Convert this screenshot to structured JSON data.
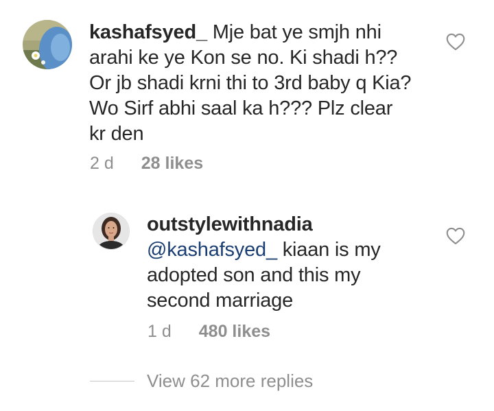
{
  "comments": [
    {
      "username": "kashafsyed_",
      "text": "Mje bat ye smjh nhi arahi ke ye Kon se no. Ki shadi h?? Or jb shadi krni thi to 3rd baby q Kia? Wo Sirf abhi saal ka h??? Plz clear kr den",
      "time": "2 d",
      "likes": "28 likes",
      "avatar_icon": "hijab-profile-photo",
      "like_icon": "heart-outline-icon"
    },
    {
      "username": "outstylewithnadia",
      "mention": "@kashafsyed_",
      "text": "kiaan is my adopted son and this my second marriage",
      "time": "1 d",
      "likes": "480 likes",
      "avatar_icon": "woman-profile-photo",
      "like_icon": "heart-outline-icon"
    }
  ],
  "view_replies": {
    "label": "View 62 more replies"
  },
  "colors": {
    "text": "#262626",
    "secondary": "#8e8e8e",
    "mention": "#1a3e72",
    "divider": "#c7c7c7"
  }
}
